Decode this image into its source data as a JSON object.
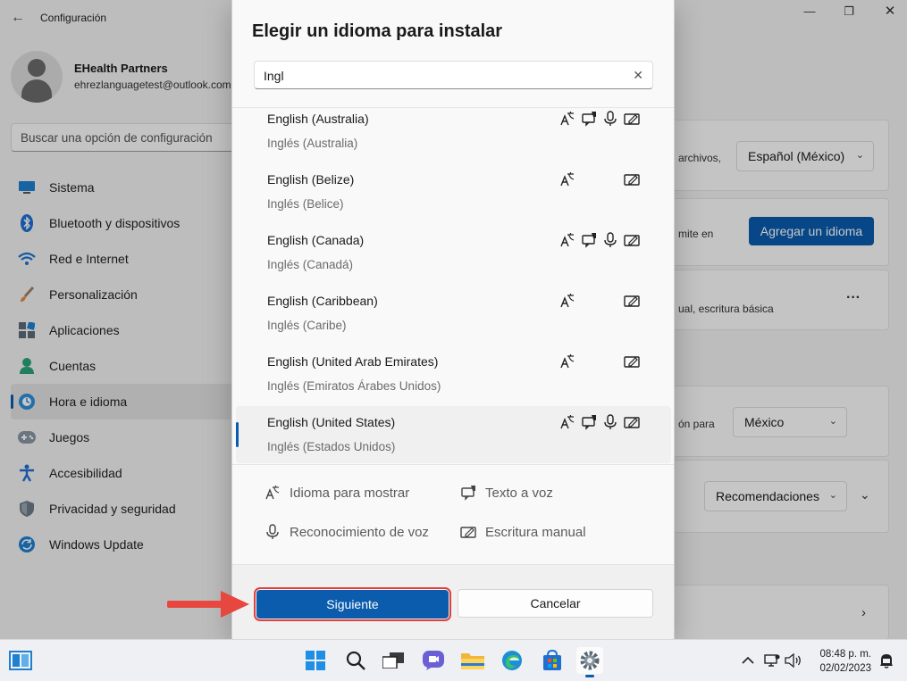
{
  "window": {
    "app_title": "Configuración",
    "user_name": "EHealth Partners",
    "user_email": "ehrezlanguagetest@outlook.com",
    "search_placeholder": "Buscar una opción de configuración"
  },
  "sidebar": {
    "items": [
      {
        "label": "Sistema",
        "icon": "system-icon"
      },
      {
        "label": "Bluetooth y dispositivos",
        "icon": "bluetooth-icon"
      },
      {
        "label": "Red e Internet",
        "icon": "wifi-icon"
      },
      {
        "label": "Personalización",
        "icon": "brush-icon"
      },
      {
        "label": "Aplicaciones",
        "icon": "apps-icon"
      },
      {
        "label": "Cuentas",
        "icon": "account-icon"
      },
      {
        "label": "Hora e idioma",
        "icon": "time-language-icon",
        "active": true
      },
      {
        "label": "Juegos",
        "icon": "gamepad-icon"
      },
      {
        "label": "Accesibilidad",
        "icon": "accessibility-icon"
      },
      {
        "label": "Privacidad y seguridad",
        "icon": "shield-icon"
      },
      {
        "label": "Windows Update",
        "icon": "update-icon"
      }
    ]
  },
  "background": {
    "card1_text": "archivos,",
    "card1_select": "Español (México)",
    "card2_text": "mite en",
    "card2_button": "Agregar un idioma",
    "card3_text": "ual, escritura básica",
    "card3_more": "···",
    "card4_text": "ón para",
    "card4_select": "México",
    "card5_select": "Recomendaciones"
  },
  "dialog": {
    "title": "Elegir un idioma para instalar",
    "search_value": "Ingl",
    "languages": [
      {
        "name": "English (Australia)",
        "native": "Inglés (Australia)",
        "features": [
          "display",
          "tts",
          "speech",
          "handwriting"
        ]
      },
      {
        "name": "English (Belize)",
        "native": "Inglés (Belice)",
        "features": [
          "display",
          "handwriting"
        ]
      },
      {
        "name": "English (Canada)",
        "native": "Inglés (Canadá)",
        "features": [
          "display",
          "tts",
          "speech",
          "handwriting"
        ]
      },
      {
        "name": "English (Caribbean)",
        "native": "Inglés (Caribe)",
        "features": [
          "display",
          "handwriting"
        ]
      },
      {
        "name": "English (United Arab Emirates)",
        "native": "Inglés (Emiratos Árabes Unidos)",
        "features": [
          "display",
          "handwriting"
        ]
      },
      {
        "name": "English (United States)",
        "native": "Inglés (Estados Unidos)",
        "features": [
          "display",
          "tts",
          "speech",
          "handwriting"
        ],
        "selected": true
      }
    ],
    "legend": {
      "display": "Idioma para mostrar",
      "tts": "Texto a voz",
      "speech": "Reconocimiento de voz",
      "handwriting": "Escritura manual"
    },
    "next_label": "Siguiente",
    "cancel_label": "Cancelar"
  },
  "taskbar": {
    "time": "08:48 p. m.",
    "date": "02/02/2023"
  },
  "colors": {
    "accent": "#0b5cad",
    "highlight_border": "#e0403e"
  }
}
